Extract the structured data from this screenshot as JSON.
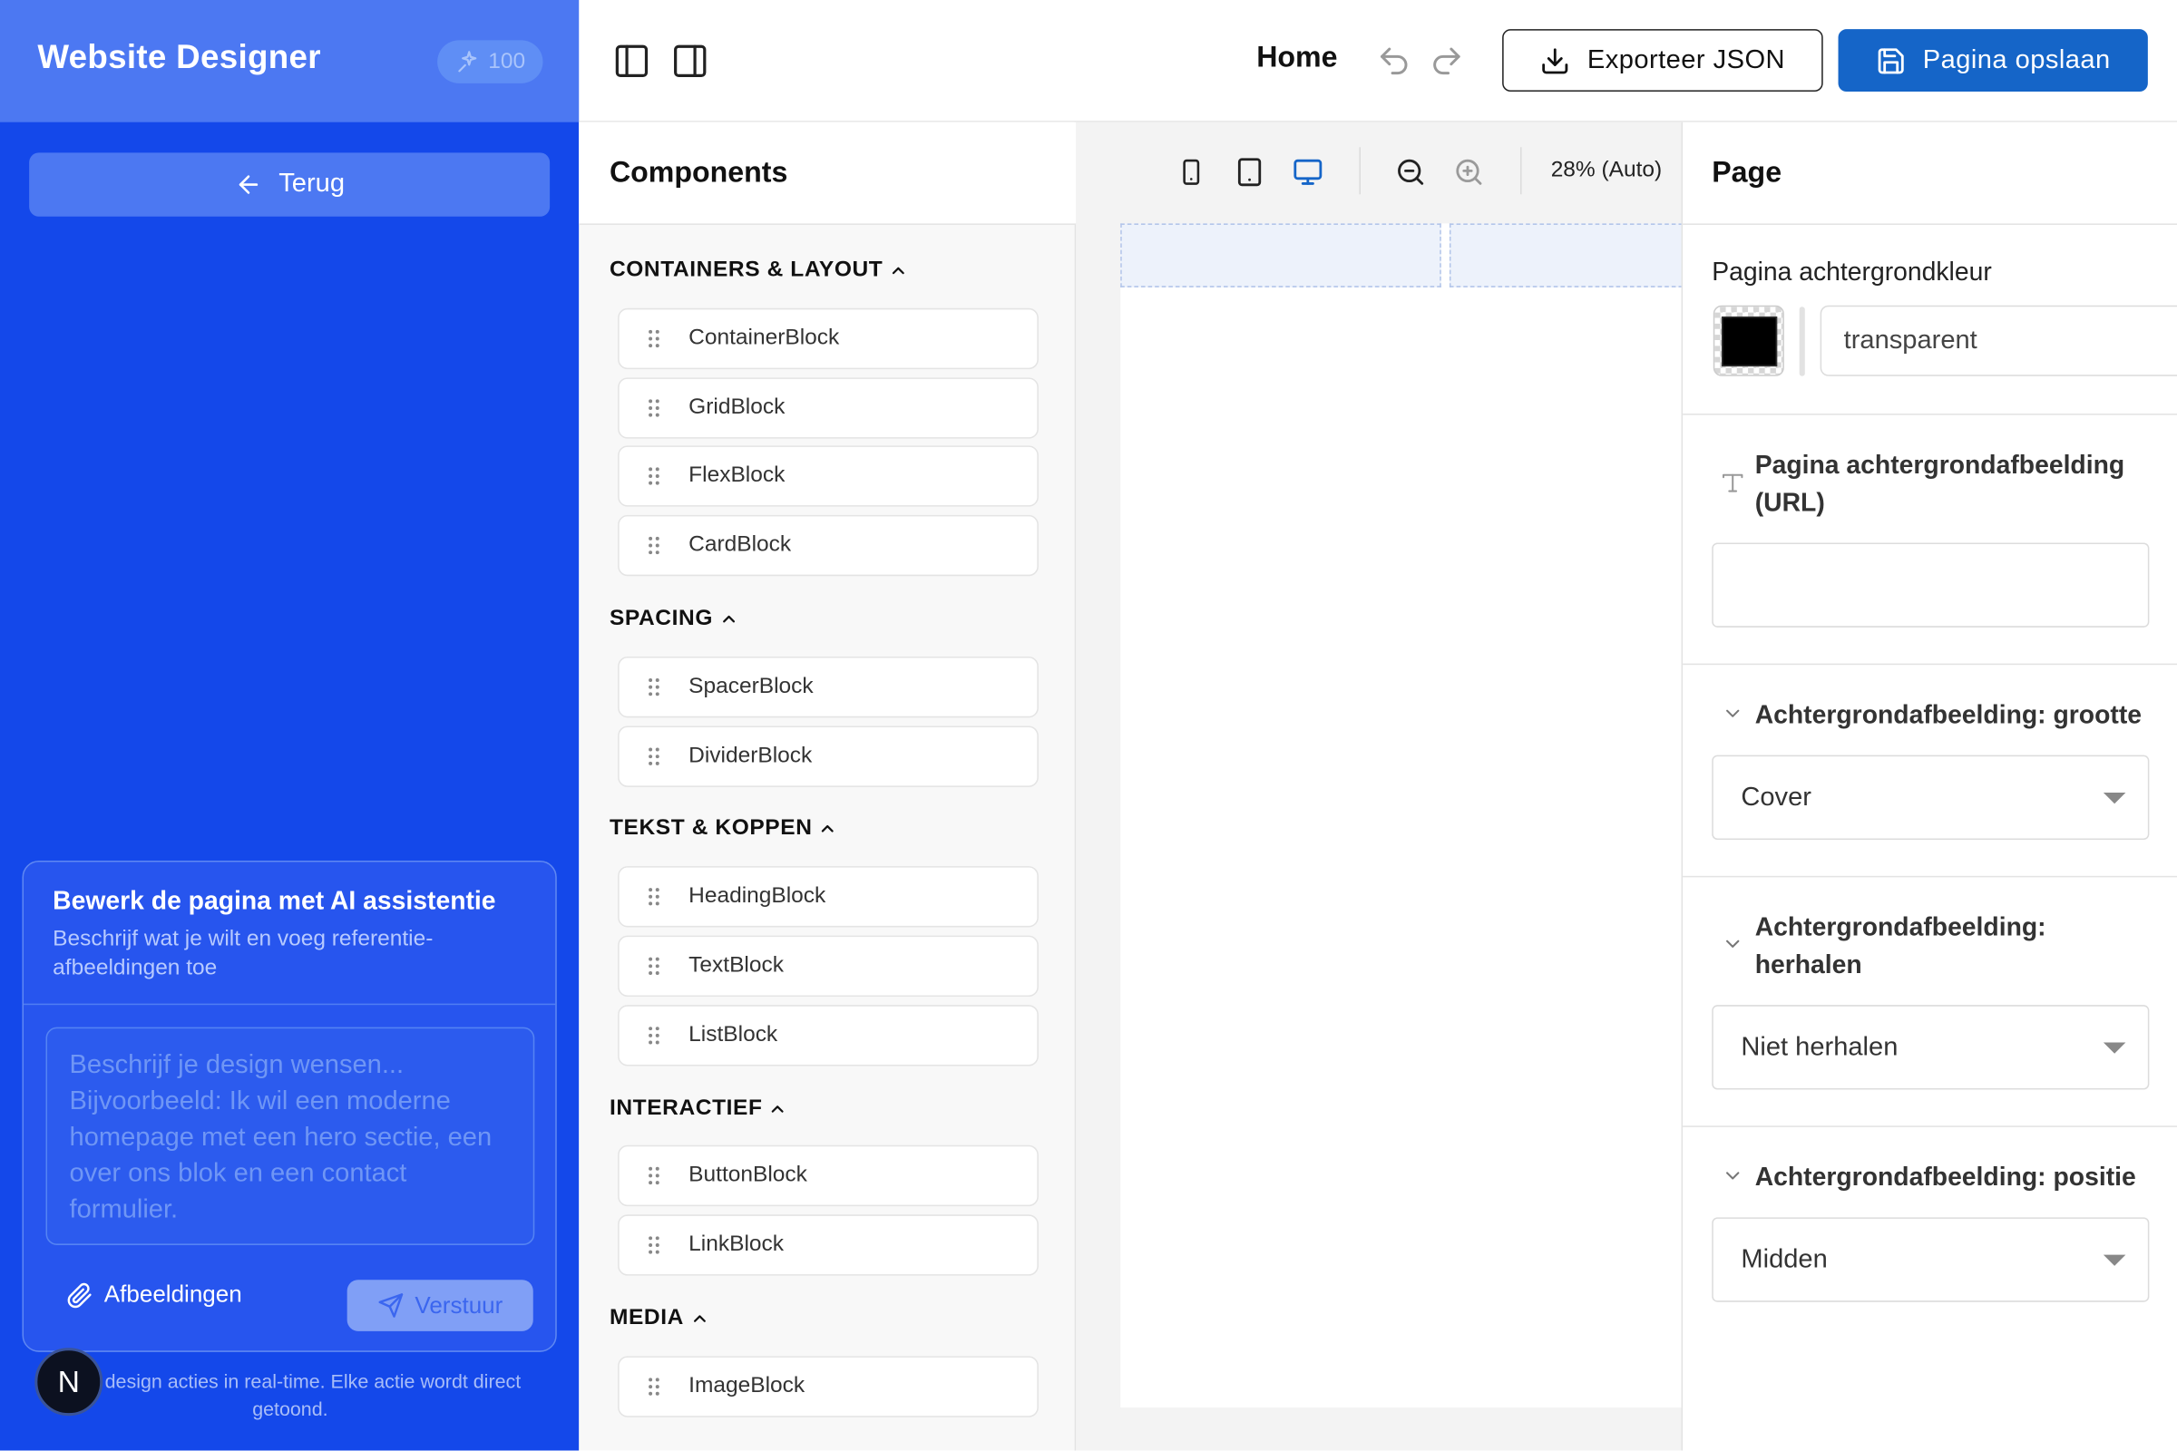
{
  "app": {
    "title": "Website Designer",
    "credits": "100",
    "back_label": "Terug"
  },
  "ai_panel": {
    "title": "Bewerk de pagina met AI assistentie",
    "subtitle": "Beschrijf wat je wilt en voeg referentie-afbeeldingen toe",
    "textarea_placeholder": "Beschrijf je design wensen... Bijvoorbeeld: Ik wil een moderne homepage met een hero sectie, een over ons blok en een contact formulier.",
    "attach_label": "Afbeeldingen",
    "send_label": "Verstuur",
    "footnote": "reert design acties in real-time. Elke actie wordt direct getoond.",
    "badge_letter": "N"
  },
  "topbar": {
    "page_name": "Home",
    "export_label": "Exporteer JSON",
    "save_label": "Pagina opslaan"
  },
  "components": {
    "title": "Components",
    "sections": [
      {
        "label": "CONTAINERS & LAYOUT",
        "items": [
          "ContainerBlock",
          "GridBlock",
          "FlexBlock",
          "CardBlock"
        ]
      },
      {
        "label": "SPACING",
        "items": [
          "SpacerBlock",
          "DividerBlock"
        ]
      },
      {
        "label": "TEKST & KOPPEN",
        "items": [
          "HeadingBlock",
          "TextBlock",
          "ListBlock"
        ]
      },
      {
        "label": "INTERACTIEF",
        "items": [
          "ButtonBlock",
          "LinkBlock"
        ]
      },
      {
        "label": "MEDIA",
        "items": [
          "ImageBlock"
        ]
      }
    ]
  },
  "canvas": {
    "zoom_label": "28% (Auto)",
    "active_device": "desktop"
  },
  "properties": {
    "title": "Page",
    "bg_color_label": "Pagina achtergrondkleur",
    "bg_color_value": "transparent",
    "bg_color_swatch": "#000000",
    "bg_image_label": "Pagina achtergrondafbeelding (URL)",
    "bg_image_value": "",
    "size_label": "Achtergrondafbeelding: grootte",
    "size_value": "Cover",
    "repeat_label": "Achtergrondafbeelding: herhalen",
    "repeat_value": "Niet herhalen",
    "position_label": "Achtergrondafbeelding: positie",
    "position_value": "Midden"
  },
  "colors": {
    "sidebar_blue": "#1448ea",
    "primary_button": "#1565c8",
    "active_device": "#1565c8"
  }
}
